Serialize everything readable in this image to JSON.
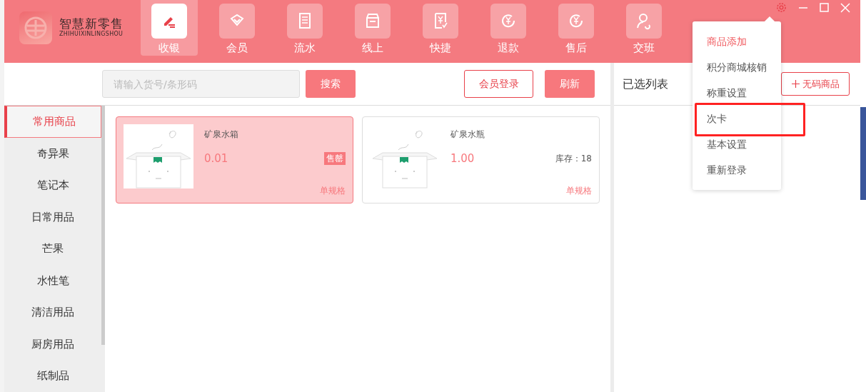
{
  "app": {
    "logo_title": "智慧新零售",
    "logo_subtitle": "ZHIHUIXINLINGSHOU"
  },
  "nav_tabs": [
    {
      "label": "收银",
      "selected": true
    },
    {
      "label": "会员",
      "selected": false
    },
    {
      "label": "流水",
      "selected": false
    },
    {
      "label": "线上",
      "selected": false
    },
    {
      "label": "快捷",
      "selected": false
    },
    {
      "label": "退款",
      "selected": false
    },
    {
      "label": "售后",
      "selected": false
    },
    {
      "label": "交班",
      "selected": false
    }
  ],
  "search": {
    "placeholder": "请输入货号/条形码",
    "button": "搜索"
  },
  "actions": [
    {
      "label": "会员登录",
      "kind": "outline"
    },
    {
      "label": "刷新",
      "kind": "solid"
    }
  ],
  "categories": [
    {
      "label": "常用商品",
      "selected": true
    },
    {
      "label": "奇异果",
      "selected": false
    },
    {
      "label": "笔记本",
      "selected": false
    },
    {
      "label": "日常用品",
      "selected": false
    },
    {
      "label": "芒果",
      "selected": false
    },
    {
      "label": "水性笔",
      "selected": false
    },
    {
      "label": "清洁用品",
      "selected": false
    },
    {
      "label": "厨房用品",
      "selected": false
    },
    {
      "label": "纸制品",
      "selected": false
    }
  ],
  "products": [
    {
      "name": "矿泉水箱",
      "price": "0.01",
      "badge": "售罄",
      "spec": "单规格",
      "selected": true
    },
    {
      "name": "矿泉水瓶",
      "price": "1.00",
      "stock": "库存：18",
      "spec": "单规格",
      "selected": false
    }
  ],
  "selected_list": {
    "title": "已选列表",
    "add_button": "无码商品"
  },
  "settings_menu": {
    "items": [
      {
        "label": "商品添加",
        "selected": true,
        "annotated": false
      },
      {
        "label": "积分商城核销",
        "selected": false,
        "annotated": false
      },
      {
        "label": "称重设置",
        "selected": false,
        "annotated": false
      },
      {
        "label": "次卡",
        "selected": false,
        "annotated": true
      },
      {
        "label": "基本设置",
        "selected": false,
        "annotated": false
      },
      {
        "label": "重新登录",
        "selected": false,
        "annotated": false
      }
    ]
  }
}
